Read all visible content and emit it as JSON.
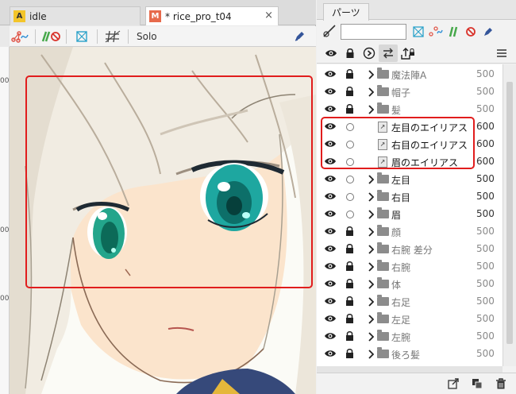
{
  "tabs": [
    {
      "label": "idle",
      "icon": "animation-file-icon",
      "badge": "A"
    },
    {
      "label": "* rice_pro_t04",
      "icon": "model-file-icon",
      "badge": "M"
    }
  ],
  "tab_close": "×",
  "toolbar": {
    "solo_label": "Solo"
  },
  "ruler": [
    {
      "label": "00"
    },
    {
      "label": "00"
    },
    {
      "label": "00"
    }
  ],
  "panel": {
    "title": "パーツ",
    "search": {
      "value": "",
      "placeholder": ""
    }
  },
  "parts": [
    {
      "name": "魔法陣A",
      "value": "500",
      "kind": "folder",
      "lock": true
    },
    {
      "name": "帽子",
      "value": "500",
      "kind": "folder",
      "lock": true
    },
    {
      "name": "髪",
      "value": "500",
      "kind": "folder",
      "lock": true
    },
    {
      "name": "左目のエイリアス",
      "value": "600",
      "kind": "alias",
      "lock": false
    },
    {
      "name": "右目のエイリアス",
      "value": "600",
      "kind": "alias",
      "lock": false
    },
    {
      "name": "眉のエイリアス",
      "value": "600",
      "kind": "alias",
      "lock": false
    },
    {
      "name": "左目",
      "value": "500",
      "kind": "folder-dark",
      "lock": false
    },
    {
      "name": "右目",
      "value": "500",
      "kind": "folder-dark",
      "lock": false
    },
    {
      "name": "眉",
      "value": "500",
      "kind": "folder-dark",
      "lock": false
    },
    {
      "name": "顔",
      "value": "500",
      "kind": "folder",
      "lock": true
    },
    {
      "name": "右腕 差分",
      "value": "500",
      "kind": "folder",
      "lock": true
    },
    {
      "name": "右腕",
      "value": "500",
      "kind": "folder",
      "lock": true
    },
    {
      "name": "体",
      "value": "500",
      "kind": "folder",
      "lock": true
    },
    {
      "name": "右足",
      "value": "500",
      "kind": "folder",
      "lock": true
    },
    {
      "name": "左足",
      "value": "500",
      "kind": "folder",
      "lock": true
    },
    {
      "name": "左腕",
      "value": "500",
      "kind": "folder",
      "lock": true
    },
    {
      "name": "後ろ髪",
      "value": "500",
      "kind": "folder",
      "lock": true
    }
  ],
  "colors": {
    "highlight": "#e11d1d",
    "accent_blue": "#2f8fd6",
    "accent_green": "#46a84a",
    "accent_red": "#d9332b",
    "eye_teal": "#1ea7a0"
  }
}
